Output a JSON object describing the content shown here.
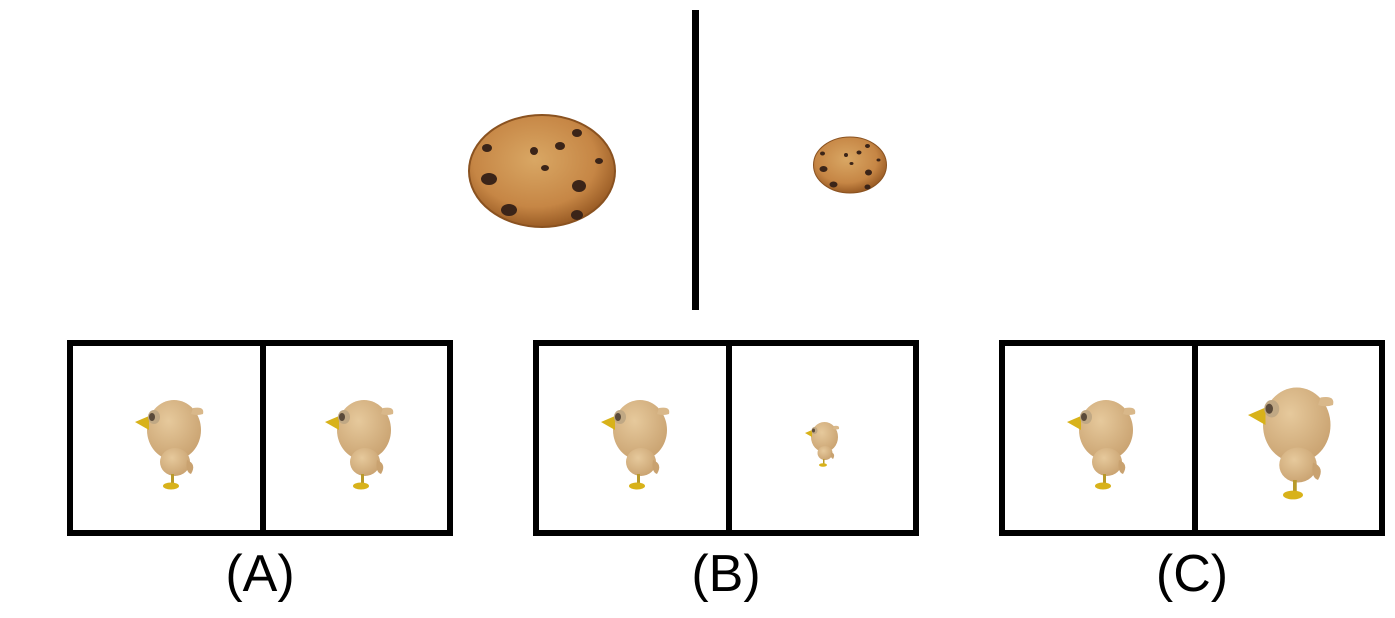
{
  "stimulus": {
    "left_object": "cookie-large",
    "right_object": "cookie-small"
  },
  "options": [
    {
      "label": "(A)",
      "left": "bird-same",
      "right": "bird-same"
    },
    {
      "label": "(B)",
      "left": "bird-same",
      "right": "bird-small"
    },
    {
      "label": "(C)",
      "left": "bird-same",
      "right": "bird-large"
    }
  ],
  "colors": {
    "cookie": "#c98a4b",
    "chip": "#3b2418",
    "bird_body": "#d9b88a",
    "beak": "#d8b21a"
  }
}
